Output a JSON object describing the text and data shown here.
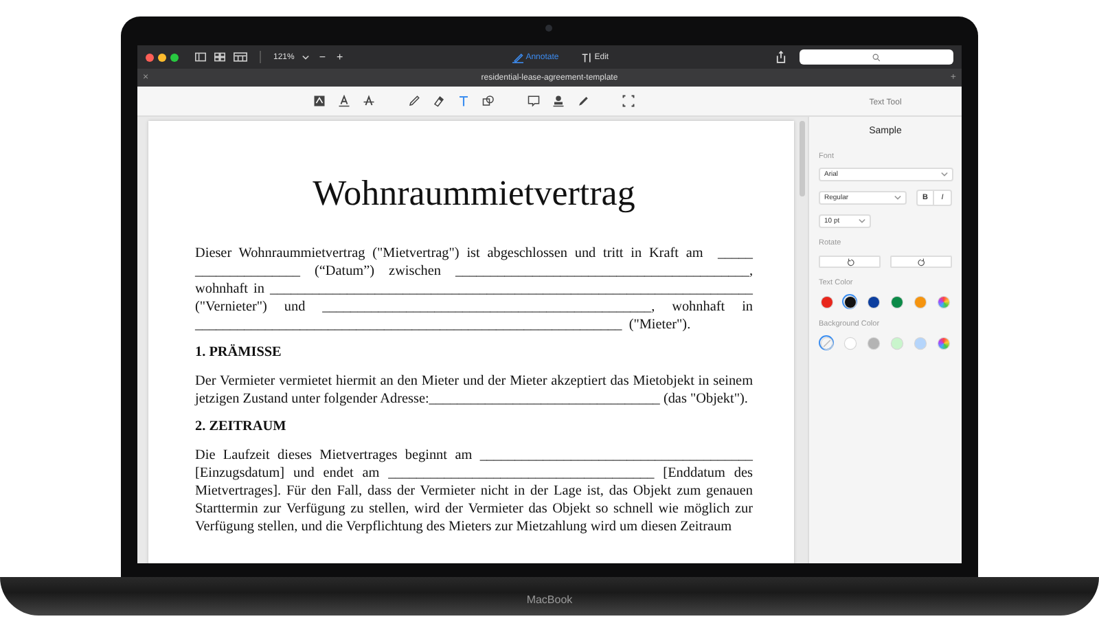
{
  "toolbar": {
    "zoom": "121%",
    "zoom_out": "−",
    "zoom_in": "+",
    "modes": [
      {
        "kind": "annotate",
        "label": "Annotate",
        "selected": true
      },
      {
        "kind": "edit",
        "label": "Edit",
        "selected": false
      }
    ]
  },
  "tab": {
    "close": "×",
    "title": "residential-lease-agreement-template",
    "add": "+"
  },
  "annotation_tools": [
    {
      "kind": "textbox",
      "selected": false
    },
    {
      "kind": "underline",
      "selected": false
    },
    {
      "kind": "strike",
      "selected": false
    },
    {
      "kind": "pencil",
      "selected": false
    },
    {
      "kind": "eraser",
      "selected": false
    },
    {
      "kind": "text",
      "selected": true
    },
    {
      "kind": "shape",
      "selected": false
    },
    {
      "kind": "note",
      "selected": false
    },
    {
      "kind": "stamp",
      "selected": false
    },
    {
      "kind": "signature",
      "selected": false
    },
    {
      "kind": "crop",
      "selected": false
    }
  ],
  "document": {
    "title": "Wohnraummietvertrag",
    "blocks": [
      {
        "kind": "para",
        "lines": [
          "Dieser Wohnraummietvertrag (\"Mietvertrag\") ist abgeschlossen und tritt in Kraft am  _____",
          "_______________ (“Datum”) zwischen __________________________________________,",
          "wohnhaft in _____________________________________________________________________",
          "(\"Vernieter\") und _______________________________________________, wohnhaft in",
          "_____________________________________________________________  (\"Mieter\")."
        ]
      },
      {
        "kind": "heading",
        "lines": [
          "1. PRÄMISSE"
        ]
      },
      {
        "kind": "para",
        "lines": [
          "Der Vermieter vermietet hiermit an den Mieter und der Mieter akzeptiert das Mietobjekt in seinem",
          "jetzigen Zustand unter folgender Adresse:_________________________________ (das \"Objekt\")."
        ]
      },
      {
        "kind": "heading",
        "lines": [
          "2. ZEITRAUM"
        ]
      },
      {
        "kind": "para",
        "lines": [
          "Die Laufzeit dieses Mietvertrages beginnt am _______________________________________",
          "[Einzugsdatum] und endet am ______________________________________ [Enddatum des",
          "Mietvertrages]. Für den Fall, dass der Vermieter nicht in der Lage ist, das Objekt zum genauen",
          "Starttermin zur Verfügung zu stellen, wird der Vermieter das Objekt so schnell wie möglich zur",
          "Verfügung stellen, und die Verpflichtung des Mieters zur Mietzahlung wird um diesen Zeitraum"
        ]
      }
    ]
  },
  "sidebar": {
    "title": "Text Tool",
    "sample": "Sample",
    "font_label": "Font",
    "font": "Arial",
    "style": "Regular",
    "bold": "B",
    "italic": "I",
    "size": "10 pt",
    "rotate_label": "Rotate",
    "text_color_label": "Text Color",
    "text_colors": [
      {
        "kind": "color",
        "color": "#e8261c",
        "selected": false
      },
      {
        "kind": "color",
        "color": "#111111",
        "selected": true
      },
      {
        "kind": "color",
        "color": "#0d3f9f",
        "selected": false
      },
      {
        "kind": "color",
        "color": "#0c8a48",
        "selected": false
      },
      {
        "kind": "color",
        "color": "#f5940f",
        "selected": false
      },
      {
        "kind": "spectrum",
        "selected": false
      }
    ],
    "background_color_label": "Background Color",
    "background_colors": [
      {
        "kind": "none",
        "selected": true
      },
      {
        "kind": "color",
        "color": "#ffffff",
        "selected": false
      },
      {
        "kind": "color",
        "color": "#b4b4b4",
        "selected": false
      },
      {
        "kind": "color",
        "color": "#c9f5cc",
        "selected": false
      },
      {
        "kind": "color",
        "color": "#b5d5fb",
        "selected": false
      },
      {
        "kind": "spectrum",
        "selected": false
      }
    ]
  },
  "laptop_label": "MacBook"
}
